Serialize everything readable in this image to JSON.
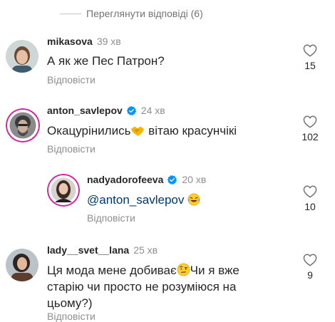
{
  "view_replies": "Переглянути відповіді (6)",
  "reply_label": "Відповісти",
  "comments": [
    {
      "user": "mikasova",
      "time": "39 хв",
      "text": "А як же Пес Патрон?",
      "likes": "15"
    },
    {
      "user": "anton_savlepov",
      "time": "24 хв",
      "text_before": "Окацурінились",
      "text_after": " вітаю красунчікі",
      "likes": "102"
    },
    {
      "user": "nadyadorofeeva",
      "time": "20 хв",
      "mention": "@anton_savlepov",
      "likes": "10"
    },
    {
      "user": "lady__svet__lana",
      "time": "25 хв",
      "text_line1_before": "Ця мода мене добиває",
      "text_line1_after": "Чи я вже",
      "text_line2": "старію чи просто не розуміюся на",
      "text_line3": "цьому?)",
      "likes": "9"
    }
  ],
  "colors": {
    "username": "#262626",
    "secondary": "#8e8e8e",
    "mention": "#00376b",
    "verified": "#0095f6",
    "story_ring": "#d6249f"
  },
  "icons": [
    "heart-outline-icon",
    "verified-badge-icon",
    "handshake-emoji",
    "laughing-emoji",
    "raised-eyebrow-emoji"
  ]
}
